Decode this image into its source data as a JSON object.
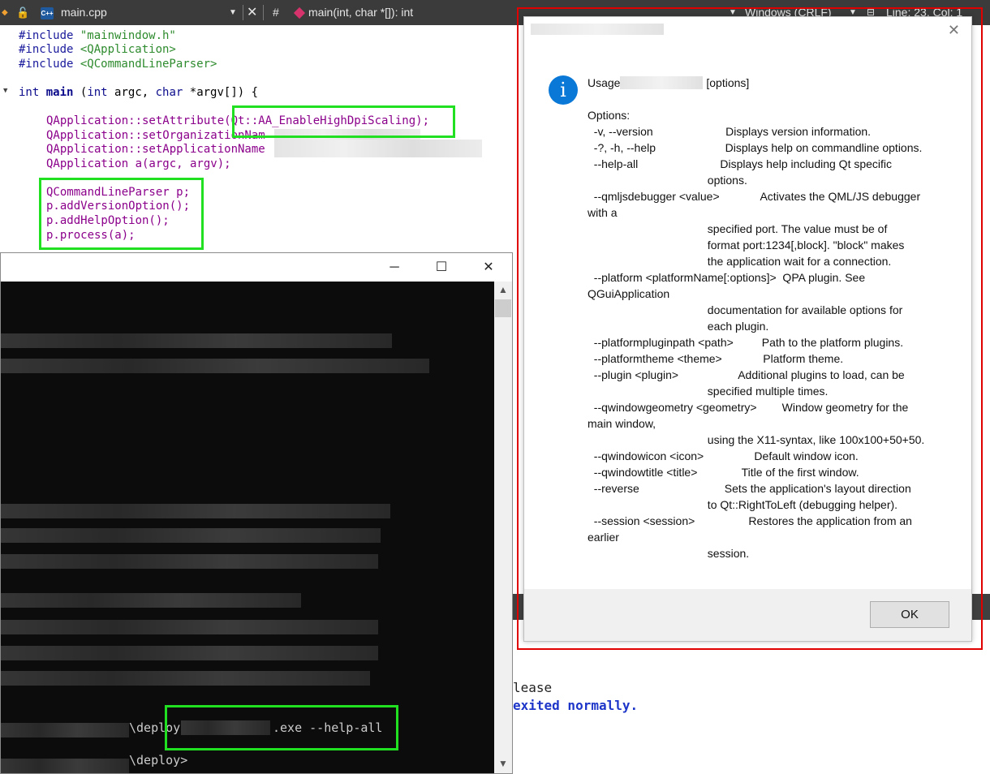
{
  "editor": {
    "file_name": "main.cpp",
    "file_type_badge": "C++",
    "hash_symbol": "#",
    "function_crumb": "main(int, char *[]): int",
    "line_ending": "Windows (CRLF)",
    "cursor_position": "Line: 23, Col: 1",
    "code": {
      "l1_directive": "#include ",
      "l1_arg": "\"mainwindow.h\"",
      "l2_directive": "#include ",
      "l2_arg": "<QApplication>",
      "l3_directive": "#include ",
      "l3_arg": "<QCommandLineParser>",
      "l4_int": "int ",
      "l4_main": "main ",
      "l4_open": "(",
      "l4_int2": "int ",
      "l4_argc": "argc, ",
      "l4_char": "char ",
      "l4_rest": "*argv[]) {",
      "l5": "QApplication::setAttribute(Qt::AA_EnableHighDpiScaling);",
      "l6": "QApplication::setOrganizationNam",
      "l7": "QApplication::setApplicationName",
      "l8": "QApplication a(argc, argv);",
      "l9": "QCommandLineParser p;",
      "l10": "p.addVersionOption();",
      "l11": "p.addHelpOption();",
      "l12": "p.process(a);"
    }
  },
  "console": {
    "minimize_glyph": "─",
    "maximize_glyph": "☐",
    "close_glyph": "✕",
    "scroll_up_glyph": "▲",
    "scroll_down_glyph": "▼",
    "cmd_prefix": "\\deploy",
    "cmd_suffix": ".exe --help-all",
    "prompt2": "\\deploy>"
  },
  "output": {
    "line1": "lease",
    "line2": "exited normally."
  },
  "dialog": {
    "close_glyph": "✕",
    "info_glyph": "i",
    "usage_prefix": "Usage",
    "usage_suffix": "[options]",
    "help_text": "Options:\n  -v, --version                       Displays version information.\n  -?, -h, --help                      Displays help on commandline options.\n  --help-all                          Displays help including Qt specific\n                                      options.\n  --qmljsdebugger <value>             Activates the QML/JS debugger\nwith a\n                                      specified port. The value must be of\n                                      format port:1234[,block]. \"block\" makes\n                                      the application wait for a connection.\n  --platform <platformName[:options]>  QPA plugin. See\nQGuiApplication\n                                      documentation for available options for\n                                      each plugin.\n  --platformpluginpath <path>         Path to the platform plugins.\n  --platformtheme <theme>             Platform theme.\n  --plugin <plugin>                   Additional plugins to load, can be\n                                      specified multiple times.\n  --qwindowgeometry <geometry>        Window geometry for the\nmain window,\n                                      using the X11-syntax, like 100x100+50+50.\n  --qwindowicon <icon>                Default window icon.\n  --qwindowtitle <title>              Title of the first window.\n  --reverse                           Sets the application's layout direction\n                                      to Qt::RightToLeft (debugging helper).\n  --session <session>                 Restores the application from an\nearlier\n                                      session.",
    "ok_label": "OK"
  },
  "colors": {
    "highlight_green": "#21e021",
    "highlight_red": "#e00000",
    "info_blue": "#0a78d7"
  }
}
